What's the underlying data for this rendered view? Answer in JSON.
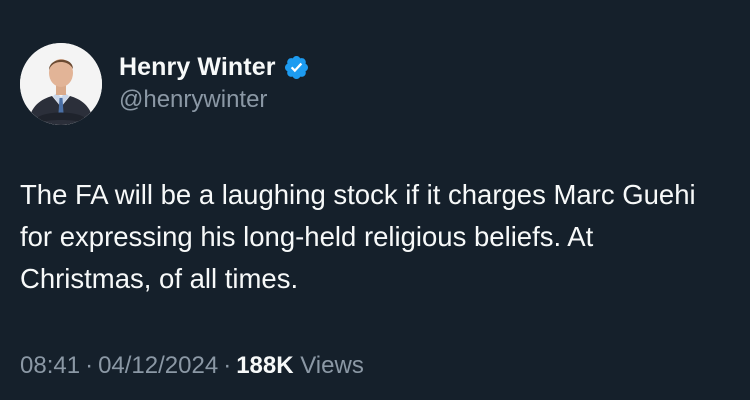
{
  "author": {
    "display_name": "Henry Winter",
    "handle": "@henrywinter",
    "verified": true,
    "verified_icon": "verified-badge-icon",
    "avatar_icon": "profile-photo"
  },
  "tweet": {
    "text": "The FA will be a laughing stock if it charges Marc Guehi for expressing his long-held religious beliefs. At Christmas, of all times."
  },
  "meta": {
    "time": "08:41",
    "separator": "·",
    "date": "04/12/2024",
    "views_count": "188K",
    "views_label": "Views"
  },
  "colors": {
    "background": "#15202b",
    "primary_text": "#f7f9f9",
    "secondary_text": "#8b98a5",
    "verified_badge": "#1d9bf0"
  }
}
